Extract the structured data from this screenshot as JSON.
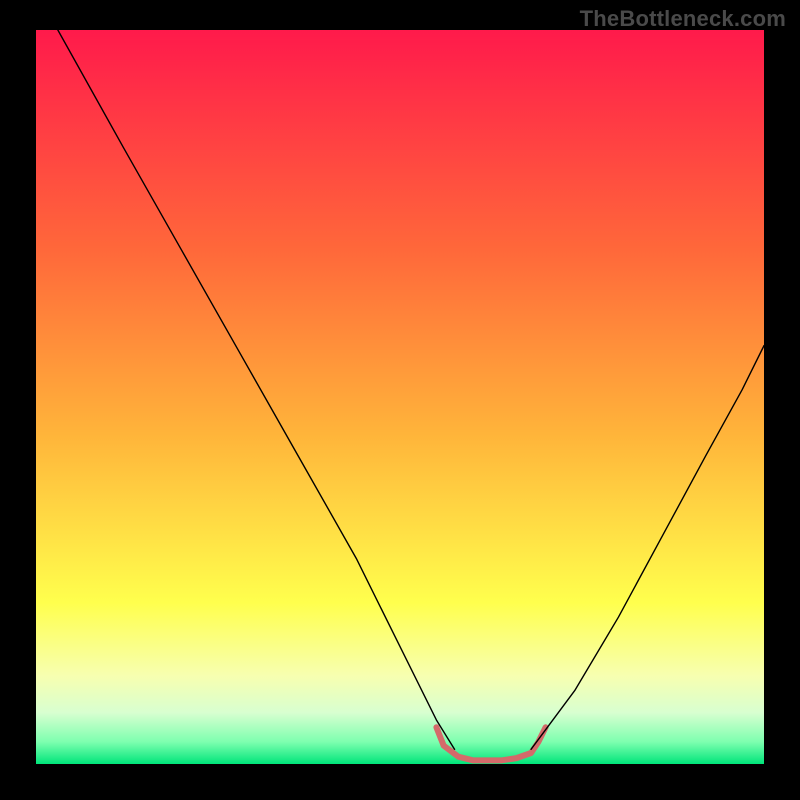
{
  "watermark": "TheBottleneck.com",
  "chart_data": {
    "type": "line",
    "title": "",
    "xlabel": "",
    "ylabel": "",
    "xlim": [
      0,
      100
    ],
    "ylim": [
      0,
      100
    ],
    "background_gradient": {
      "stops": [
        {
          "offset": 0.0,
          "color": "#ff1a4b"
        },
        {
          "offset": 0.3,
          "color": "#ff683a"
        },
        {
          "offset": 0.55,
          "color": "#ffb43a"
        },
        {
          "offset": 0.78,
          "color": "#ffff4d"
        },
        {
          "offset": 0.88,
          "color": "#f7ffb0"
        },
        {
          "offset": 0.93,
          "color": "#d8ffd0"
        },
        {
          "offset": 0.97,
          "color": "#7dffaf"
        },
        {
          "offset": 1.0,
          "color": "#00e57a"
        }
      ]
    },
    "series": [
      {
        "name": "curve-left",
        "stroke": "#000000",
        "x": [
          3,
          12,
          20,
          28,
          36,
          44,
          50,
          55,
          57.5
        ],
        "y": [
          100,
          84,
          70,
          56,
          42,
          28,
          16,
          6,
          2
        ]
      },
      {
        "name": "flat-valley",
        "stroke": "#d46a6a",
        "stroke_width": 6,
        "x": [
          55,
          56,
          58,
          60,
          62,
          64,
          66,
          68,
          69,
          70
        ],
        "y": [
          5,
          2.5,
          1,
          0.5,
          0.5,
          0.5,
          0.8,
          1.5,
          3,
          5
        ]
      },
      {
        "name": "curve-right",
        "stroke": "#000000",
        "x": [
          68,
          74,
          80,
          86,
          92,
          97,
          100
        ],
        "y": [
          2,
          10,
          20,
          31,
          42,
          51,
          57
        ]
      }
    ]
  }
}
